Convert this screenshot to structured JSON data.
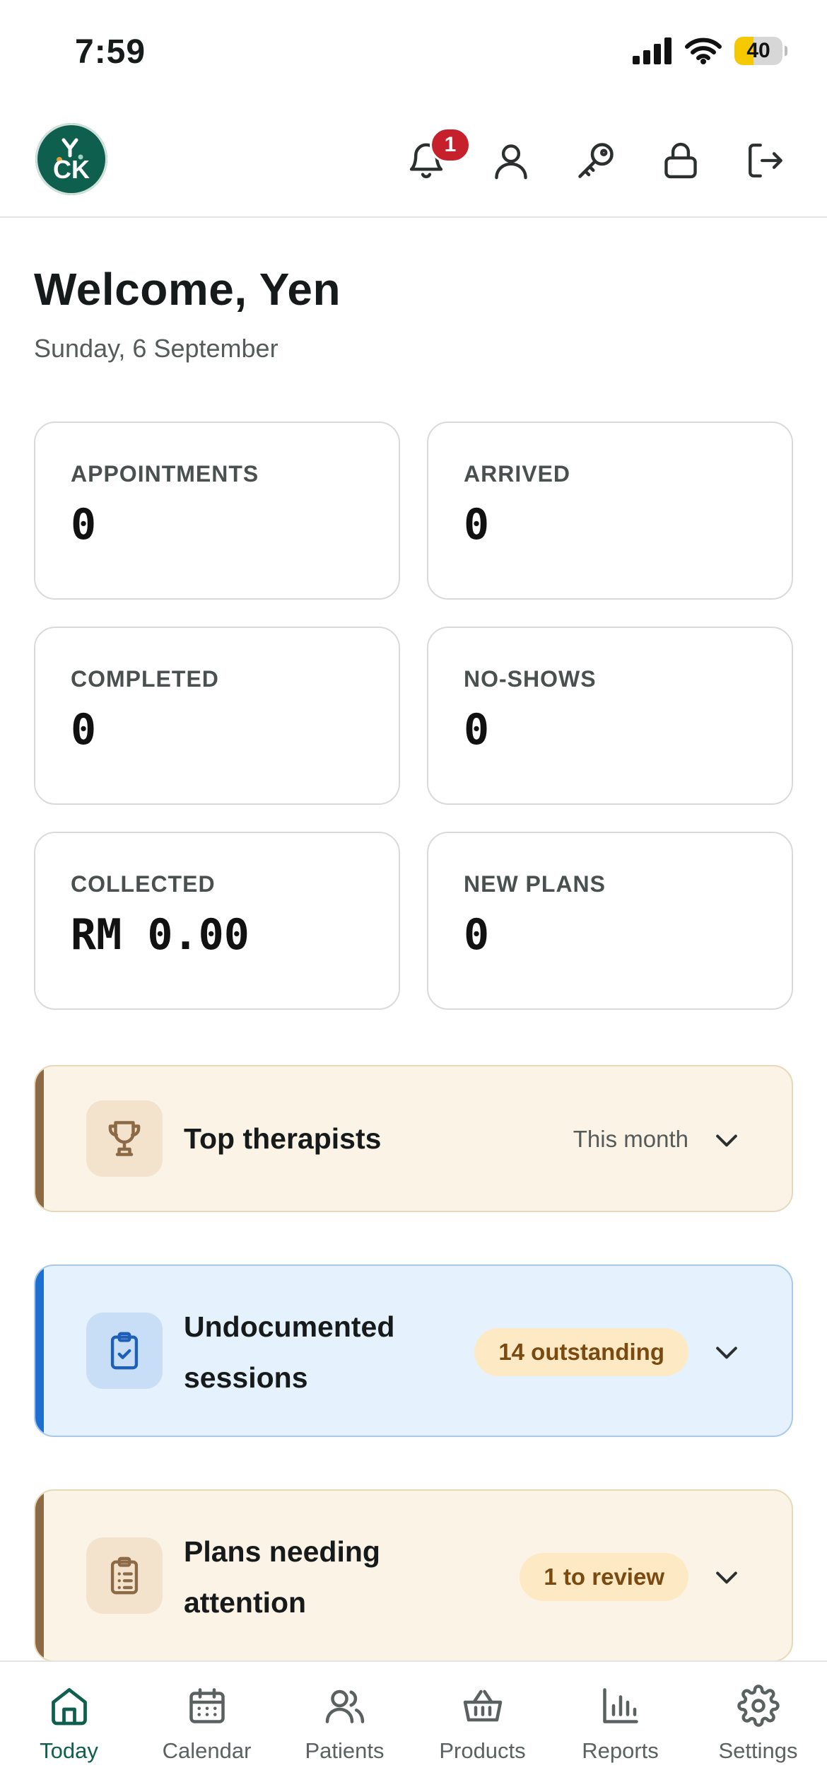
{
  "status_bar": {
    "time": "7:59",
    "battery": "40",
    "battery_level": 0.4
  },
  "header": {
    "logo_text": "CK",
    "notification_count": "1",
    "icons": [
      "bell-icon",
      "user-icon",
      "key-icon",
      "lock-icon",
      "logout-icon"
    ]
  },
  "welcome": {
    "title": "Welcome, Yen",
    "date": "Sunday, 6 September"
  },
  "stats": [
    {
      "label": "APPOINTMENTS",
      "value": "0"
    },
    {
      "label": "ARRIVED",
      "value": "0"
    },
    {
      "label": "COMPLETED",
      "value": "0"
    },
    {
      "label": "NO-SHOWS",
      "value": "0"
    },
    {
      "label": "COLLECTED",
      "value": "RM 0.00"
    },
    {
      "label": "NEW PLANS",
      "value": "0"
    }
  ],
  "panels": {
    "top_therapists": {
      "title": "Top therapists",
      "meta": "This month",
      "icon": "trophy-icon"
    },
    "undocumented": {
      "title_line1": "Undocumented",
      "title_line2": "sessions",
      "pill": "14 outstanding",
      "icon": "clipboard-check-icon"
    },
    "plans": {
      "title_line1": "Plans needing",
      "title_line2": "attention",
      "pill": "1 to review",
      "icon": "clipboard-list-icon"
    }
  },
  "colors": {
    "brand": "#0f5f4f",
    "badge": "#c6202c",
    "warm_accent": "#8b6a45",
    "blue_accent": "#1e6fcf"
  },
  "bottom_nav": [
    {
      "label": "Today",
      "icon": "home-icon",
      "active": true
    },
    {
      "label": "Calendar",
      "icon": "calendar-icon"
    },
    {
      "label": "Patients",
      "icon": "users-icon"
    },
    {
      "label": "Products",
      "icon": "basket-icon"
    },
    {
      "label": "Reports",
      "icon": "bar-chart-icon"
    },
    {
      "label": "Settings",
      "icon": "gear-icon"
    }
  ]
}
